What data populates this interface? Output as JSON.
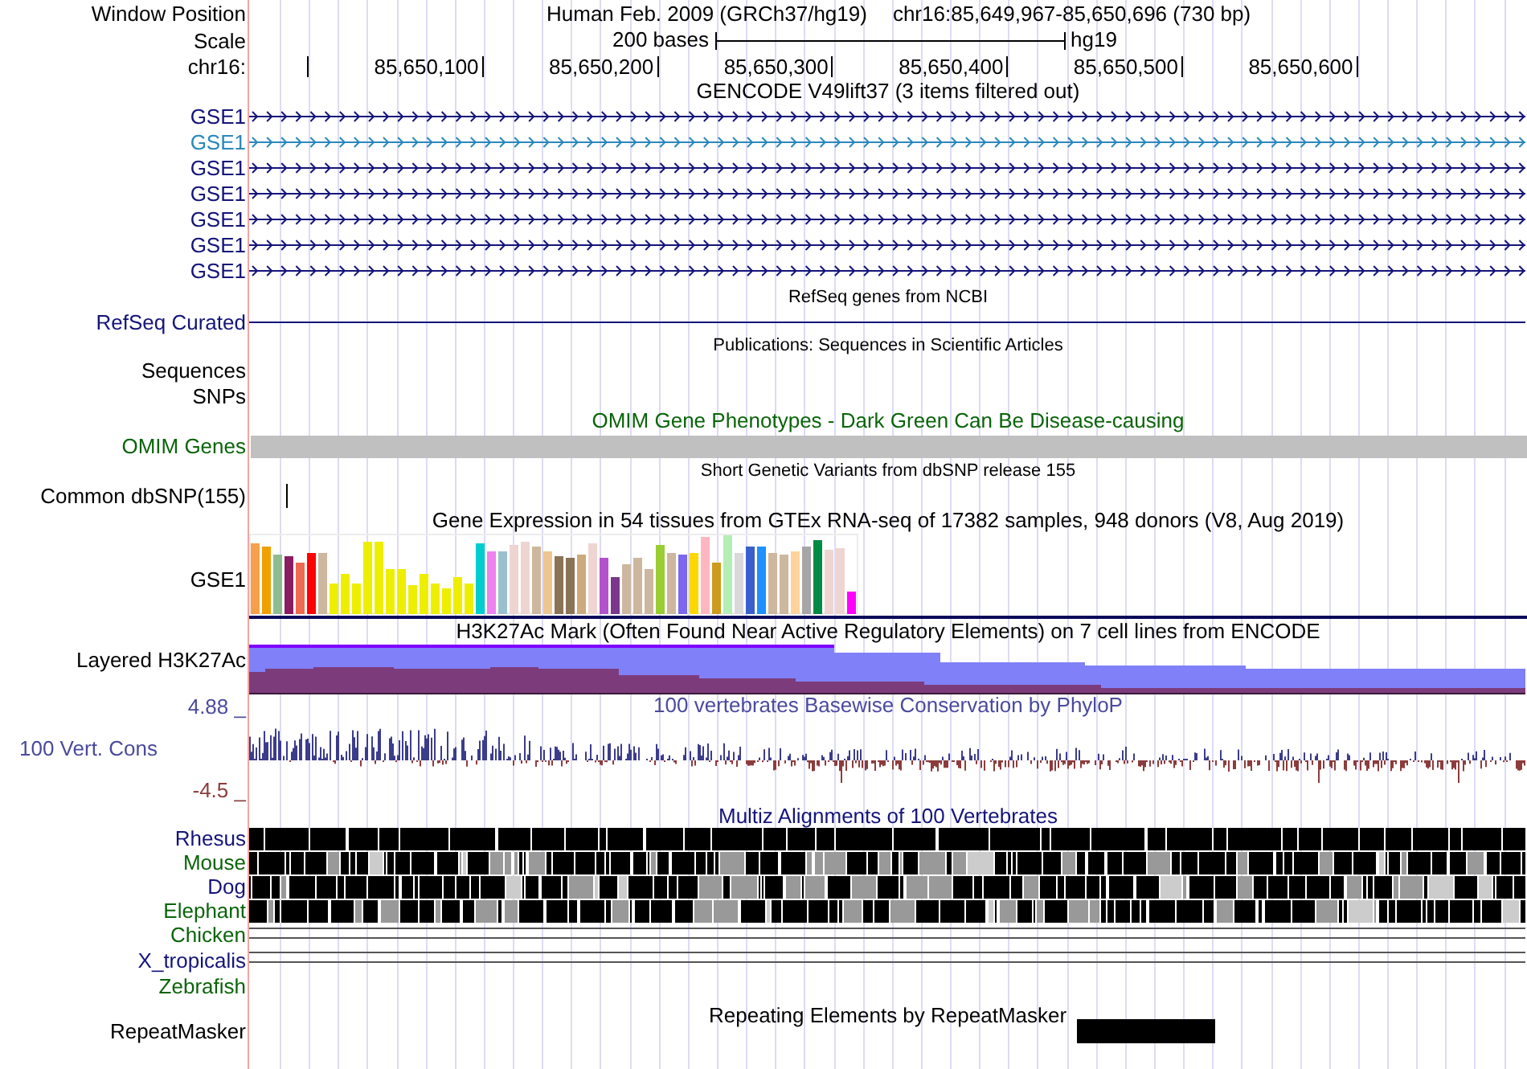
{
  "header": {
    "window_position_label": "Window Position",
    "assembly": "Human Feb. 2009 (GRCh37/hg19)",
    "position": "chr16:85,649,967-85,650,696 (730 bp)",
    "scale_label": "Scale",
    "scale_text": "200 bases",
    "scale_assembly": "hg19",
    "chrom_label": "chr16:",
    "ruler_ticks": [
      "85,650,100",
      "85,650,200",
      "85,650,300",
      "85,650,400",
      "85,650,500",
      "85,650,600"
    ]
  },
  "tracks": [
    {
      "kind": "genes",
      "title": "GENCODE V49lift37 (3 items filtered out)",
      "items": [
        {
          "label": "GSE1",
          "color": "#14147a"
        },
        {
          "label": "GSE1",
          "color": "#2a88bc"
        },
        {
          "label": "GSE1",
          "color": "#14147a"
        },
        {
          "label": "GSE1",
          "color": "#14147a"
        },
        {
          "label": "GSE1",
          "color": "#14147a"
        },
        {
          "label": "GSE1",
          "color": "#14147a"
        },
        {
          "label": "GSE1",
          "color": "#14147a"
        }
      ]
    },
    {
      "kind": "line",
      "title": "RefSeq genes from NCBI",
      "label": "RefSeq Curated",
      "color": "#14147a"
    },
    {
      "kind": "empty",
      "title": "Publications: Sequences in Scientific Articles",
      "labels": [
        "Sequences",
        "SNPs"
      ]
    },
    {
      "kind": "bar",
      "title": "OMIM Gene Phenotypes - Dark Green Can Be Disease-causing",
      "label": "OMIM Genes",
      "color": "#0a640a"
    },
    {
      "kind": "snp",
      "title": "Short Genetic Variants from dbSNP release 155",
      "label": "Common dbSNP(155)"
    },
    {
      "kind": "expression",
      "title": "Gene Expression in 54 tissues from GTEx RNA-seq of 17382 samples, 948 donors (V8, Aug 2019)",
      "label": "GSE1"
    },
    {
      "kind": "layered",
      "title": "H3K27Ac Mark (Often Found Near Active Regulatory Elements) on 7 cell lines from ENCODE",
      "label": "Layered H3K27Ac"
    },
    {
      "kind": "conservation",
      "title": "100 vertebrates Basewise Conservation by PhyloP",
      "label": "100 Vert. Cons",
      "max": "4.88 _",
      "min": "-4.5 _",
      "color": "#4a4a9e"
    },
    {
      "kind": "alignment",
      "title": "Multiz Alignments of 100 Vertebrates",
      "color": "#14147a",
      "species": [
        {
          "label": "Rhesus",
          "color": "#14147a",
          "kind": "blocks"
        },
        {
          "label": "Mouse",
          "color": "#0a640a",
          "kind": "blocks"
        },
        {
          "label": "Dog",
          "color": "#14147a",
          "kind": "blocks"
        },
        {
          "label": "Elephant",
          "color": "#0a640a",
          "kind": "blocks"
        },
        {
          "label": "Chicken",
          "color": "#0a640a",
          "kind": "lines"
        },
        {
          "label": "X_tropicalis",
          "color": "#14147a",
          "kind": "lines"
        },
        {
          "label": "Zebrafish",
          "color": "#0a640a",
          "kind": "none"
        }
      ]
    },
    {
      "kind": "repeats",
      "title": "Repeating Elements by RepeatMasker",
      "label": "RepeatMasker"
    }
  ]
}
